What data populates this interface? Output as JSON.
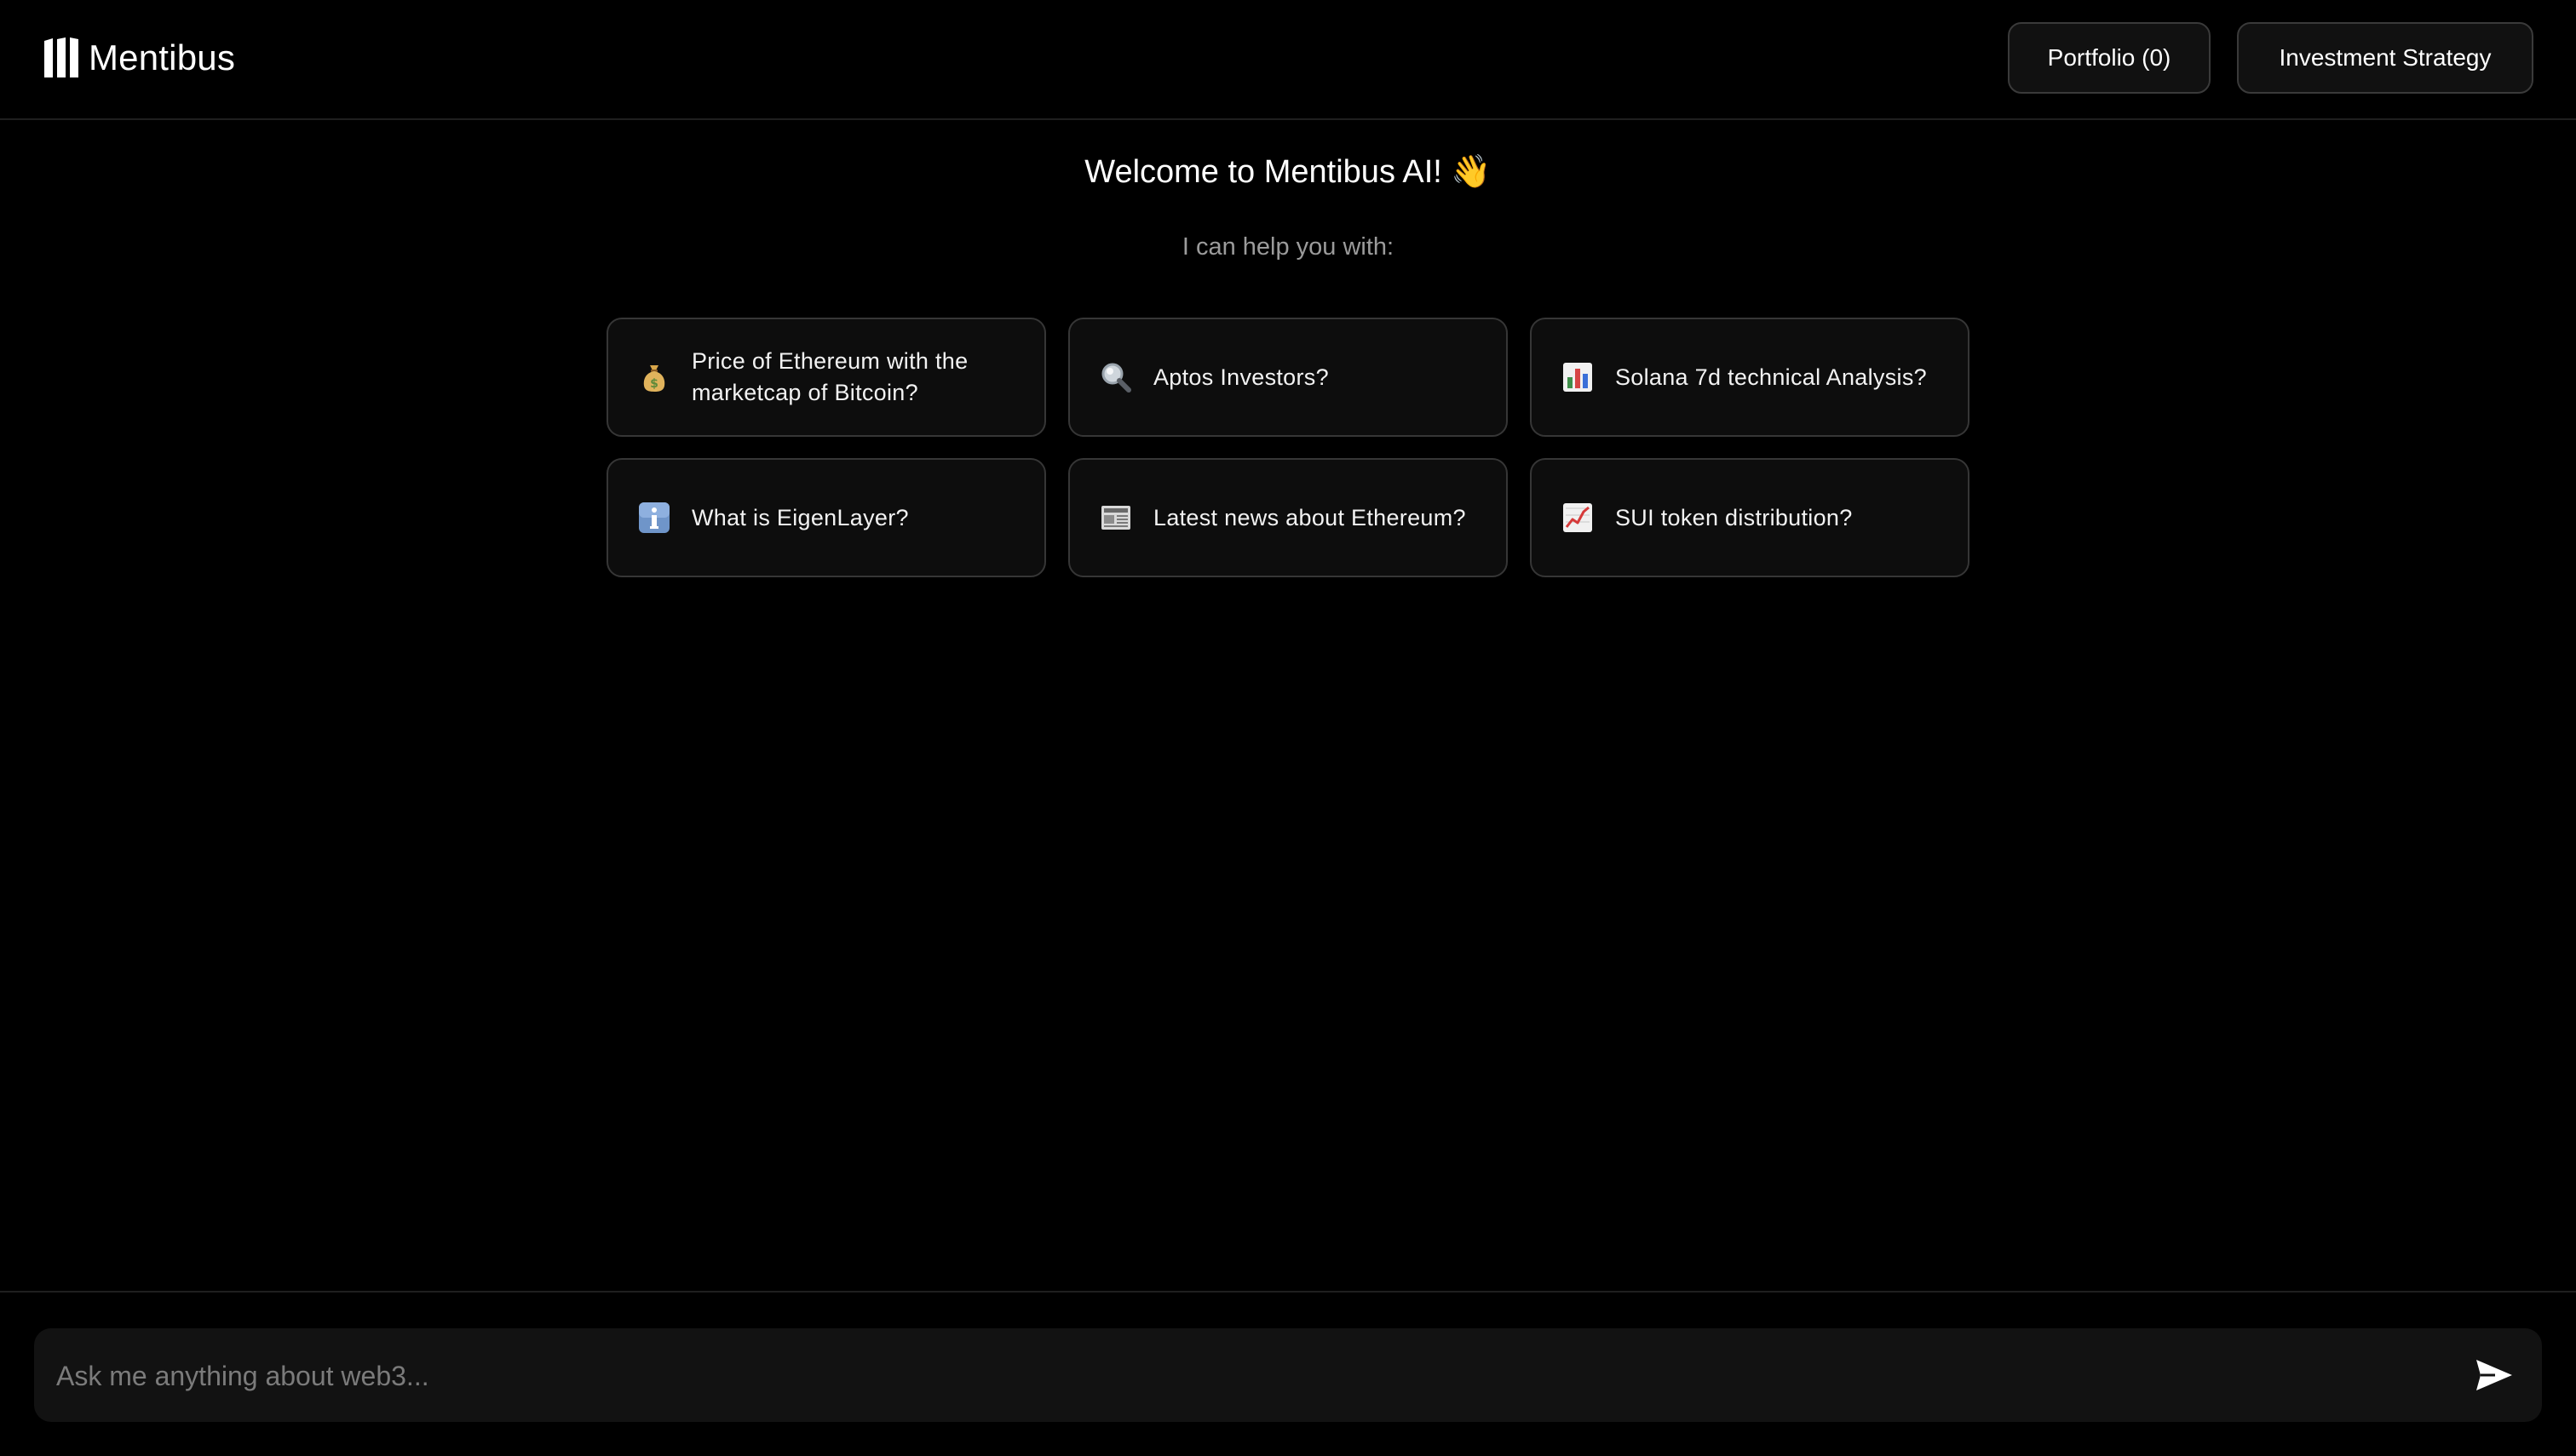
{
  "header": {
    "brand": "Mentibus",
    "portfolio_label": "Portfolio (0)",
    "strategy_label": "Investment Strategy"
  },
  "welcome": {
    "title": "Welcome to Mentibus AI! 👋",
    "subtitle": "I can help you with:"
  },
  "suggestions": [
    {
      "icon": "money-bag-icon",
      "label": "Price of Ethereum with the marketcap of Bitcoin?"
    },
    {
      "icon": "magnifying-glass-icon",
      "label": "Aptos Investors?"
    },
    {
      "icon": "bar-chart-icon",
      "label": "Solana 7d technical Analysis?"
    },
    {
      "icon": "information-icon",
      "label": "What is EigenLayer?"
    },
    {
      "icon": "newspaper-icon",
      "label": "Latest news about Ethereum?"
    },
    {
      "icon": "chart-increasing-icon",
      "label": "SUI token distribution?"
    }
  ],
  "chat": {
    "placeholder": "Ask me anything about web3...",
    "value": ""
  },
  "colors": {
    "background": "#000000",
    "card_background": "#0d0d0d",
    "border": "#363636",
    "muted_text": "#9b9b9b"
  }
}
